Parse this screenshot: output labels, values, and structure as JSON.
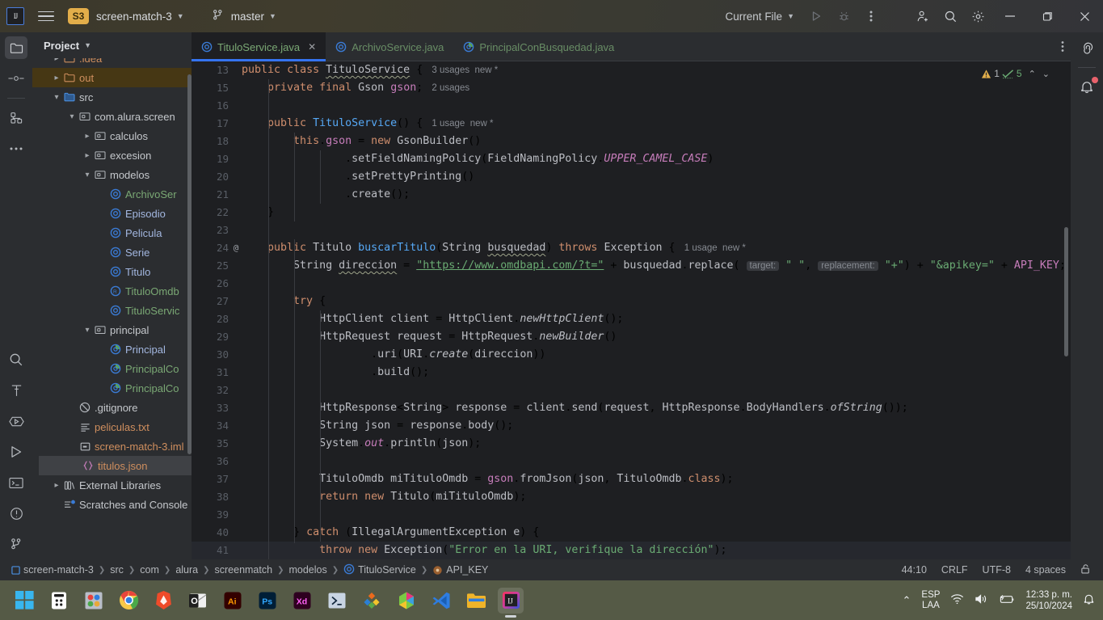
{
  "titlebar": {
    "logo_label": "IJ",
    "project_badge": "S3",
    "project_name": "screen-match-3",
    "branch": "master",
    "run_config": "Current File",
    "icons": [
      "menu-icon",
      "project-badge",
      "chevron-down-icon",
      "branch-icon",
      "run-icon",
      "debug-icon",
      "more-icon",
      "add-user-icon",
      "search-icon",
      "settings-icon",
      "minimize-icon",
      "maximize-icon",
      "close-icon"
    ]
  },
  "left_rail": {
    "items": [
      {
        "name": "project-tool-window",
        "icon": "folder-icon",
        "selected": true
      },
      {
        "name": "commit-tool-window",
        "icon": "commit-icon",
        "selected": false
      },
      {
        "name": "structure-tool-window",
        "icon": "structure-icon",
        "selected": false
      },
      {
        "name": "more-tool-windows",
        "icon": "more-icon",
        "selected": false
      }
    ],
    "bottom_items": [
      {
        "name": "search-everywhere",
        "icon": "search-icon"
      },
      {
        "name": "build-tool-window",
        "icon": "hammer-icon"
      },
      {
        "name": "debug-tool-window",
        "icon": "debug-icon"
      },
      {
        "name": "run-tool-window",
        "icon": "run-icon"
      },
      {
        "name": "terminal-tool-window",
        "icon": "terminal-icon"
      },
      {
        "name": "problems-tool-window",
        "icon": "problems-icon"
      },
      {
        "name": "git-tool-window",
        "icon": "git-icon"
      }
    ]
  },
  "right_rail": {
    "items": [
      {
        "name": "ai-assistant",
        "icon": "spiral-icon"
      },
      {
        "name": "notifications",
        "icon": "bell-icon",
        "badge": true
      }
    ]
  },
  "project_panel": {
    "title": "Project",
    "tree": [
      {
        "indent": 1,
        "arrow": "collapsed",
        "icon": "folder-icon",
        "label": ".idea",
        "color": "orange",
        "state": "normal"
      },
      {
        "indent": 1,
        "arrow": "collapsed",
        "icon": "folder-icon",
        "label": "out",
        "color": "orange",
        "state": "highlight"
      },
      {
        "indent": 1,
        "arrow": "expanded",
        "icon": "source-root-icon",
        "label": "src",
        "color": "gray",
        "state": "normal"
      },
      {
        "indent": 2,
        "arrow": "expanded",
        "icon": "package-icon",
        "label": "com.alura.screen",
        "color": "gray",
        "state": "normal"
      },
      {
        "indent": 3,
        "arrow": "collapsed",
        "icon": "package-icon",
        "label": "calculos",
        "color": "gray",
        "state": "normal"
      },
      {
        "indent": 3,
        "arrow": "collapsed",
        "icon": "package-icon",
        "label": "excesion",
        "color": "gray",
        "state": "normal"
      },
      {
        "indent": 3,
        "arrow": "expanded",
        "icon": "package-icon",
        "label": "modelos",
        "color": "gray",
        "state": "normal"
      },
      {
        "indent": 4,
        "arrow": "none",
        "icon": "class-icon",
        "label": "ArchivoSer",
        "color": "green",
        "state": "normal"
      },
      {
        "indent": 4,
        "arrow": "none",
        "icon": "class-icon",
        "label": "Episodio",
        "color": "blue",
        "state": "normal"
      },
      {
        "indent": 4,
        "arrow": "none",
        "icon": "class-icon",
        "label": "Pelicula",
        "color": "blue",
        "state": "normal"
      },
      {
        "indent": 4,
        "arrow": "none",
        "icon": "class-icon",
        "label": "Serie",
        "color": "blue",
        "state": "normal"
      },
      {
        "indent": 4,
        "arrow": "none",
        "icon": "class-icon",
        "label": "Titulo",
        "color": "blue",
        "state": "normal"
      },
      {
        "indent": 4,
        "arrow": "none",
        "icon": "record-icon",
        "label": "TituloOmdb",
        "color": "green",
        "state": "normal"
      },
      {
        "indent": 4,
        "arrow": "none",
        "icon": "class-icon",
        "label": "TituloServic",
        "color": "green",
        "state": "normal"
      },
      {
        "indent": 3,
        "arrow": "expanded",
        "icon": "package-icon",
        "label": "principal",
        "color": "gray",
        "state": "normal"
      },
      {
        "indent": 4,
        "arrow": "none",
        "icon": "main-class-icon",
        "label": "Principal",
        "color": "blue",
        "state": "normal"
      },
      {
        "indent": 4,
        "arrow": "none",
        "icon": "main-class-icon",
        "label": "PrincipalCo",
        "color": "green",
        "state": "normal"
      },
      {
        "indent": 4,
        "arrow": "none",
        "icon": "main-class-icon",
        "label": "PrincipalCo",
        "color": "green",
        "state": "normal"
      },
      {
        "indent": 2,
        "arrow": "none",
        "icon": "gitignore-icon",
        "label": ".gitignore",
        "color": "gray",
        "state": "normal"
      },
      {
        "indent": 2,
        "arrow": "none",
        "icon": "text-file-icon",
        "label": "peliculas.txt",
        "color": "orange",
        "state": "normal"
      },
      {
        "indent": 2,
        "arrow": "none",
        "icon": "iml-icon",
        "label": "screen-match-3.iml",
        "color": "orange",
        "state": "normal"
      },
      {
        "indent": 2,
        "arrow": "none",
        "icon": "json-icon",
        "label": "titulos.json",
        "color": "orange",
        "state": "selected"
      },
      {
        "indent": 1,
        "arrow": "collapsed",
        "icon": "library-icon",
        "label": "External Libraries",
        "color": "gray",
        "state": "normal"
      },
      {
        "indent": 1,
        "arrow": "none",
        "icon": "scratches-icon",
        "label": "Scratches and Console",
        "color": "gray",
        "state": "normal"
      }
    ]
  },
  "editor": {
    "tabs": [
      {
        "label": "TituloService.java",
        "icon": "class-icon",
        "color": "green",
        "active": true,
        "closable": true
      },
      {
        "label": "ArchivoService.java",
        "icon": "class-icon",
        "color": "green",
        "active": false,
        "closable": false
      },
      {
        "label": "PrincipalConBusquedad.java",
        "icon": "main-class-icon",
        "color": "green",
        "active": false,
        "closable": false
      }
    ],
    "inspections": {
      "warning_count": "1",
      "check_count": "5"
    },
    "lines": [
      {
        "num": "13",
        "gutter": ""
      },
      {
        "num": "15",
        "gutter": ""
      },
      {
        "num": "16",
        "gutter": ""
      },
      {
        "num": "17",
        "gutter": ""
      },
      {
        "num": "18",
        "gutter": ""
      },
      {
        "num": "19",
        "gutter": ""
      },
      {
        "num": "20",
        "gutter": ""
      },
      {
        "num": "21",
        "gutter": ""
      },
      {
        "num": "22",
        "gutter": ""
      },
      {
        "num": "23",
        "gutter": ""
      },
      {
        "num": "24",
        "gutter": "@"
      },
      {
        "num": "25",
        "gutter": ""
      },
      {
        "num": "26",
        "gutter": ""
      },
      {
        "num": "27",
        "gutter": ""
      },
      {
        "num": "28",
        "gutter": ""
      },
      {
        "num": "29",
        "gutter": ""
      },
      {
        "num": "30",
        "gutter": ""
      },
      {
        "num": "31",
        "gutter": ""
      },
      {
        "num": "32",
        "gutter": ""
      },
      {
        "num": "33",
        "gutter": ""
      },
      {
        "num": "34",
        "gutter": ""
      },
      {
        "num": "35",
        "gutter": ""
      },
      {
        "num": "36",
        "gutter": ""
      },
      {
        "num": "37",
        "gutter": ""
      },
      {
        "num": "38",
        "gutter": ""
      },
      {
        "num": "39",
        "gutter": ""
      },
      {
        "num": "40",
        "gutter": ""
      },
      {
        "num": "41",
        "gutter": ""
      }
    ],
    "code_text": [
      "public class TituloService {   3 usages  new *",
      "    private final Gson gson;   2 usages",
      "",
      "    public TituloService() {   1 usage  new *",
      "        this.gson = new GsonBuilder()",
      "                .setFieldNamingPolicy(FieldNamingPolicy.UPPER_CAMEL_CASE)",
      "                .setPrettyPrinting()",
      "                .create();",
      "    }",
      "",
      "    public Titulo buscarTitulo(String busquedad) throws Exception {   1 usage  new *",
      "        String direccion = \"https://www.omdbapi.com/?t=\" + busquedad.replace( target: \" \",  replacement: \"+\") + \"&apikey=\" + API_KEY;",
      "",
      "        try {",
      "            HttpClient client = HttpClient.newHttpClient();",
      "            HttpRequest request = HttpRequest.newBuilder()",
      "                    .uri(URI.create(direccion))",
      "                    .build();",
      "",
      "            HttpResponse<String> response = client.send(request, HttpResponse.BodyHandlers.ofString());",
      "            String json = response.body();",
      "            System.out.println(json);",
      "",
      "            TituloOmdb miTituloOmdb = gson.fromJson(json, TituloOmdb.class);",
      "            return new Titulo(miTituloOmdb);",
      "",
      "        } catch (IllegalArgumentException e) {",
      "            throw new Exception(\"Error en la URI, verifique la dirección\");"
    ]
  },
  "status_bar": {
    "breadcrumb": [
      "screen-match-3",
      "src",
      "com",
      "alura",
      "screenmatch",
      "modelos",
      "TituloService",
      "API_KEY"
    ],
    "breadcrumb_icons": [
      "module-icon",
      "",
      "",
      "",
      "",
      "",
      "class-icon",
      "field-icon"
    ],
    "caret": "44:10",
    "line_separator": "CRLF",
    "encoding": "UTF-8",
    "indent": "4 spaces",
    "lock_icon": "unlocked-icon"
  },
  "taskbar": {
    "apps": [
      {
        "name": "windows-start",
        "label": ""
      },
      {
        "name": "app-store",
        "label": ""
      },
      {
        "name": "photos",
        "label": ""
      },
      {
        "name": "google-chrome",
        "label": ""
      },
      {
        "name": "brave-browser",
        "label": ""
      },
      {
        "name": "outlook",
        "label": ""
      },
      {
        "name": "adobe-illustrator",
        "label": "Ai"
      },
      {
        "name": "adobe-photoshop",
        "label": "Ps"
      },
      {
        "name": "adobe-xd",
        "label": "Xd"
      },
      {
        "name": "powershell",
        "label": ""
      },
      {
        "name": "blender",
        "label": ""
      },
      {
        "name": "unity",
        "label": ""
      },
      {
        "name": "visual-studio-code",
        "label": ""
      },
      {
        "name": "file-explorer",
        "label": ""
      },
      {
        "name": "intellij-idea",
        "label": "IJ"
      }
    ],
    "tray": {
      "language_line1": "ESP",
      "language_line2": "LAA",
      "time": "12:33 p. m.",
      "date": "25/10/2024"
    }
  },
  "colors": {
    "accent": "#3574f0",
    "badge": "#e3ae4a",
    "editor_bg": "#1e1f22",
    "panel_bg": "#2b2d30",
    "taskbar_bg": "#555a46",
    "string": "#6aab73",
    "keyword": "#cf8e6d",
    "class_ref": "#56a8f5",
    "field": "#c77dbb"
  }
}
